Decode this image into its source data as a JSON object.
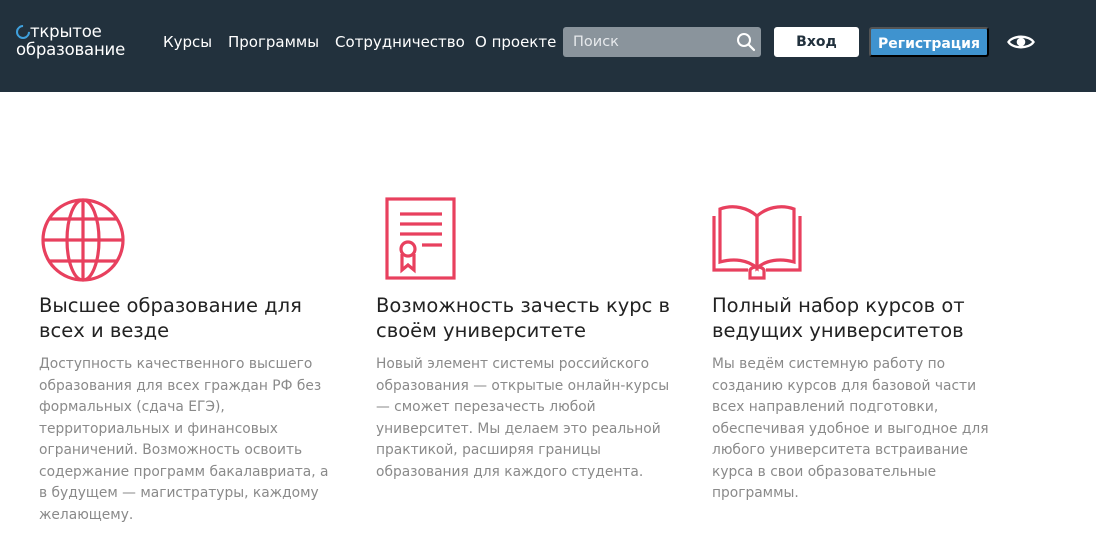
{
  "header": {
    "logo_line1": "ткрытое",
    "logo_line2": "образование",
    "nav": [
      "Курсы",
      "Программы",
      "Сотрудничество",
      "О проекте"
    ],
    "search": {
      "placeholder": "Поиск"
    },
    "login_label": "Вход",
    "register_label": "Регистрация",
    "icons": [
      "search-icon",
      "eye-icon"
    ]
  },
  "colors": {
    "header_bg": "#22313d",
    "accent_blue": "#3f93cf",
    "icon_red": "#e8405e",
    "text_dark": "#222222",
    "text_muted": "#8a8a8a"
  },
  "features": [
    {
      "icon": "globe-icon",
      "title": "Высшее образование для всех и везде",
      "description": "Доступность качественного высшего образования для всех граждан РФ без формальных (сдача ЕГЭ), территориальных и финансовых ограничений. Возможность освоить содержание программ бакалавриата, а в будущем — магистратуры, каждому желающему."
    },
    {
      "icon": "certificate-icon",
      "title": "Возможность зачесть курс в своём университете",
      "description": "Новый элемент системы российского образования — открытые онлайн-курсы — сможет перезачесть любой университет. Мы делаем это реальной практикой, расширяя границы образования для каждого студента."
    },
    {
      "icon": "open-book-icon",
      "title": "Полный набор курсов от ведущих университетов",
      "description": "Мы ведём системную работу по созданию курсов для базовой части всех направлений подготовки, обеспечивая удобное и выгодное для любого университета встраивание курса в свои образовательные программы."
    }
  ]
}
